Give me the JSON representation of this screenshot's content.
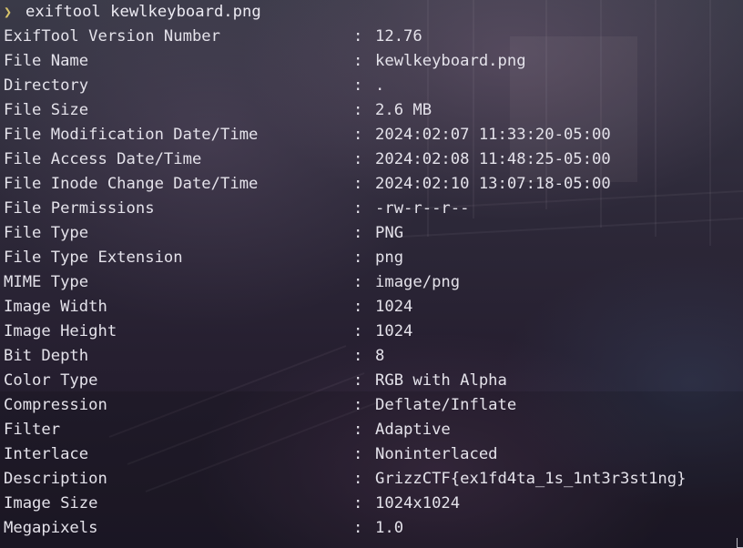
{
  "prompt": {
    "symbol": "❯",
    "command": "exiftool kewlkeyboard.png"
  },
  "separator": ":",
  "rows": [
    {
      "key": "ExifTool Version Number",
      "value": "12.76"
    },
    {
      "key": "File Name",
      "value": "kewlkeyboard.png"
    },
    {
      "key": "Directory",
      "value": "."
    },
    {
      "key": "File Size",
      "value": "2.6 MB"
    },
    {
      "key": "File Modification Date/Time",
      "value": "2024:02:07 11:33:20-05:00"
    },
    {
      "key": "File Access Date/Time",
      "value": "2024:02:08 11:48:25-05:00"
    },
    {
      "key": "File Inode Change Date/Time",
      "value": "2024:02:10 13:07:18-05:00"
    },
    {
      "key": "File Permissions",
      "value": "-rw-r--r--"
    },
    {
      "key": "File Type",
      "value": "PNG"
    },
    {
      "key": "File Type Extension",
      "value": "png"
    },
    {
      "key": "MIME Type",
      "value": "image/png"
    },
    {
      "key": "Image Width",
      "value": "1024"
    },
    {
      "key": "Image Height",
      "value": "1024"
    },
    {
      "key": "Bit Depth",
      "value": "8"
    },
    {
      "key": "Color Type",
      "value": "RGB with Alpha"
    },
    {
      "key": "Compression",
      "value": "Deflate/Inflate"
    },
    {
      "key": "Filter",
      "value": "Adaptive"
    },
    {
      "key": "Interlace",
      "value": "Noninterlaced"
    },
    {
      "key": "Description",
      "value": "GrizzCTF{ex1fd4ta_1s_1nt3r3st1ng}"
    },
    {
      "key": "Image Size",
      "value": "1024x1024"
    },
    {
      "key": "Megapixels",
      "value": "1.0"
    }
  ],
  "colors": {
    "prompt_symbol": "#d6c26a",
    "text": "#e4e2ea"
  }
}
